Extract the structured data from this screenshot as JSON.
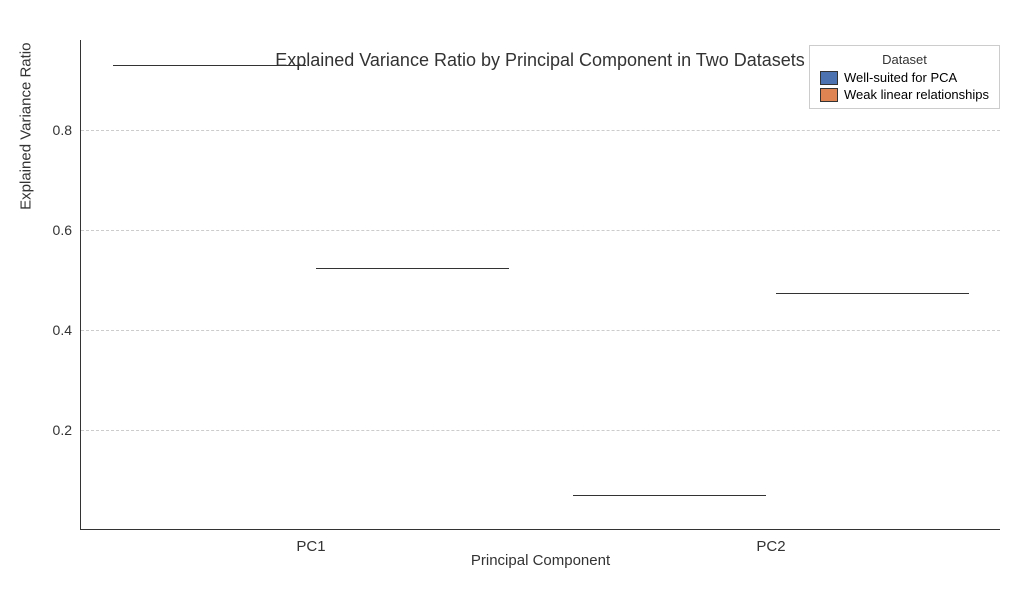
{
  "chart_data": {
    "type": "bar",
    "title": "Explained Variance Ratio by Principal Component in Two Datasets",
    "xlabel": "Principal Component",
    "ylabel": "Explained Variance Ratio",
    "categories": [
      "PC1",
      "PC2"
    ],
    "series": [
      {
        "name": "Well-suited for PCA",
        "color": "#4c72b0",
        "values": [
          0.93,
          0.07
        ]
      },
      {
        "name": "Weak linear relationships",
        "color": "#dd8452",
        "values": [
          0.525,
          0.475
        ]
      }
    ],
    "yticks": [
      0.2,
      0.4,
      0.6,
      0.8
    ],
    "ylim": [
      0.0,
      0.98
    ],
    "legend_title": "Dataset",
    "grid": true
  }
}
